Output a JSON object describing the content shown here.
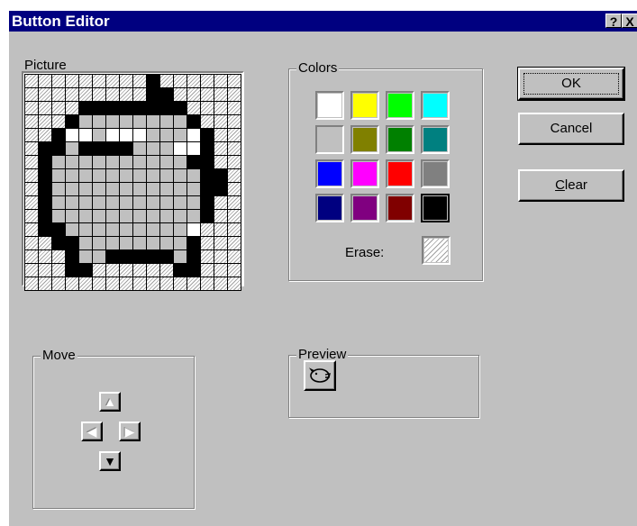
{
  "window": {
    "title": "Button Editor",
    "help_glyph": "?",
    "close_glyph": "X"
  },
  "picture": {
    "label": "Picture",
    "rows": [
      "hhhhhhhhhkhhhhhh",
      "hhhhhhhhhkkhhhhh",
      "hhhhkkkkkkkkhhhh",
      "hhhkggggggggkhhh",
      "hhkwwgwwwgggwkhh",
      "hkkgkkkkgggwwkhh",
      "hkggggggggggkkhh",
      "hkgggggggggggkkh",
      "hkgggggggggggkkh",
      "hkgggggggggggkhh",
      "hkgggggggggggkhh",
      "hkkgggggggggwhhh",
      "hhkkggggggggkhhh",
      "hhhkggkkkkkgkhhh",
      "hhhkkhhhhhhkkhhh",
      "hhhhhhhhhhhhhhhh"
    ]
  },
  "colors": {
    "label": "Colors",
    "swatches": [
      "#ffffff",
      "#ffff00",
      "#00ff00",
      "#00ffff",
      "#c0c0c0",
      "#808000",
      "#008000",
      "#008080",
      "#0000ff",
      "#ff00ff",
      "#ff0000",
      "#808080",
      "#000080",
      "#800080",
      "#800000",
      "#000000"
    ],
    "selected_index": 15,
    "erase_label": "Erase:"
  },
  "buttons": {
    "ok": "OK",
    "cancel": "Cancel",
    "clear_prefix": "C",
    "clear_rest": "lear"
  },
  "move": {
    "label": "Move",
    "up_icon": "arrow-up-icon",
    "down_icon": "arrow-down-icon",
    "left_icon": "arrow-left-icon",
    "right_icon": "arrow-right-icon"
  },
  "preview": {
    "label": "Preview",
    "icon": "piggy-bank-icon"
  }
}
